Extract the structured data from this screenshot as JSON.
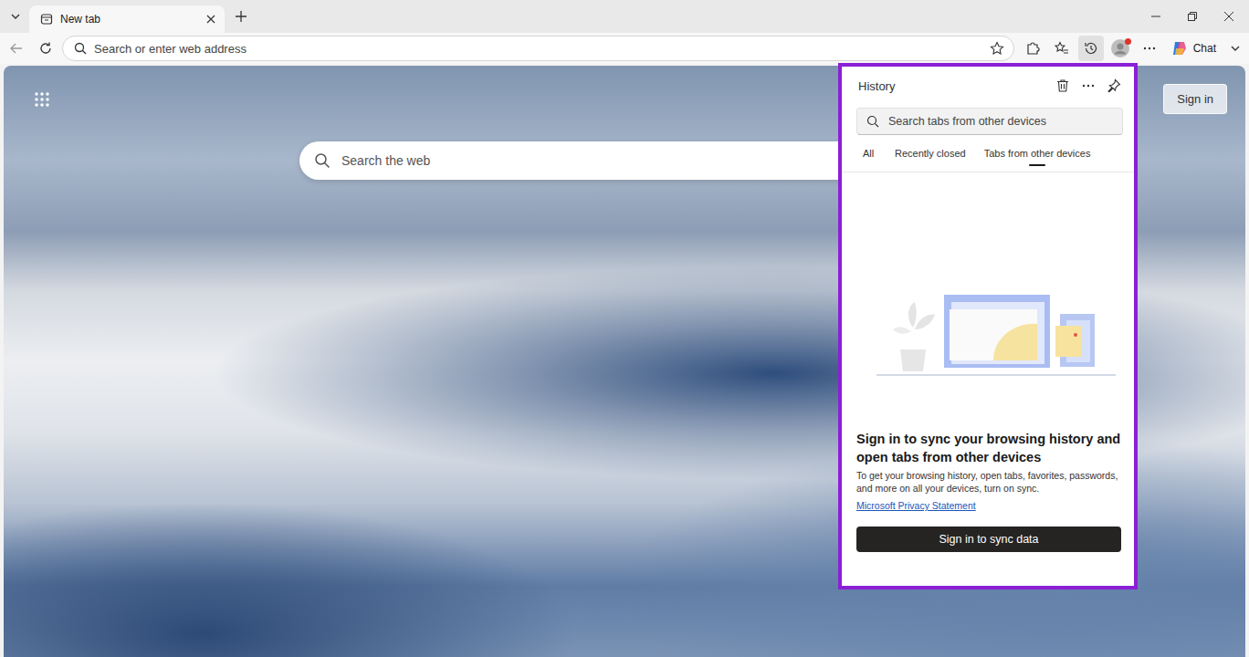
{
  "browser": {
    "tabs": [
      {
        "label": "New tab",
        "selected": true
      }
    ],
    "address_placeholder": "Search or enter web address",
    "history_button": {
      "active": true
    },
    "profile": {
      "notification": true
    },
    "chat_label": "Chat"
  },
  "page": {
    "search_placeholder": "Search the web",
    "sign_in": "Sign in"
  },
  "history_panel": {
    "title": "History",
    "search_placeholder": "Search tabs from other devices",
    "tabs": [
      {
        "label": "All",
        "selected": false
      },
      {
        "label": "Recently closed",
        "selected": false
      },
      {
        "label": "Tabs from other devices",
        "selected": true
      }
    ],
    "heading": "Sign in to sync your browsing history and open tabs from other devices",
    "body": "To get your browsing history, open tabs, favorites, passwords, and more on all your devices, turn on sync.",
    "link": "Microsoft Privacy Statement",
    "button": "Sign in to sync data"
  }
}
